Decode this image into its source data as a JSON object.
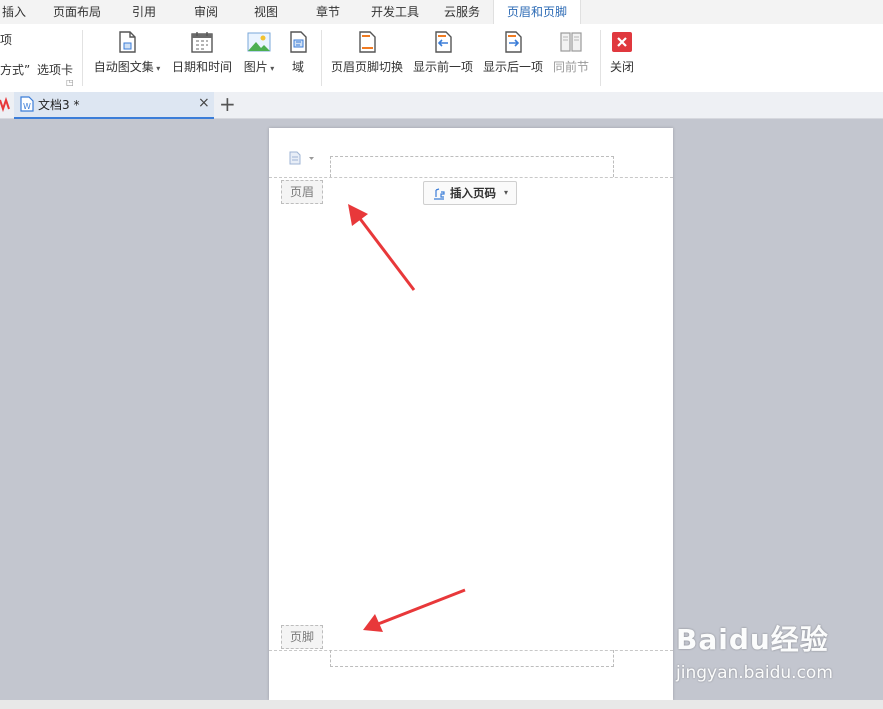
{
  "menu": {
    "tabs": [
      "插入",
      "页面布局",
      "引用",
      "审阅",
      "视图",
      "章节",
      "开发工具",
      "云服务",
      "页眉和页脚"
    ],
    "active_tab": "页眉和页脚"
  },
  "ribbon": {
    "left_partial": {
      "top": "项",
      "bottom_a": "方式”",
      "bottom_b": "选项卡"
    },
    "buttons": {
      "auto_text": "自动图文集",
      "date_time": "日期和时间",
      "picture": "图片",
      "field": "域",
      "switch": "页眉页脚切换",
      "show_prev": "显示前一项",
      "show_next": "显示后一项",
      "same_prev": "同前节",
      "close": "关闭"
    }
  },
  "doc_tabs": {
    "tab_title": "文档3 *",
    "close_glyph": "×",
    "add_glyph": "+"
  },
  "page": {
    "header_tag": "页眉",
    "footer_tag": "页脚",
    "insert_page_number": "插入页码"
  },
  "watermark": {
    "brand": "Baidu经验",
    "url": "jingyan.baidu.com"
  },
  "colors": {
    "accent": "#2d6bb5",
    "arrow": "#e8383a",
    "close_red": "#e0383e"
  }
}
